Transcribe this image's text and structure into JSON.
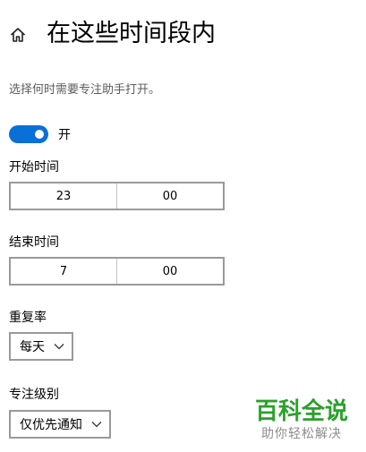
{
  "header": {
    "title": "在这些时间段内",
    "home_icon": "home-icon"
  },
  "description": "选择何时需要专注助手打开。",
  "toggle": {
    "state_label": "开",
    "on": true,
    "color": "#0a6fd6"
  },
  "start_time": {
    "label": "开始时间",
    "hour": "23",
    "minute": "00"
  },
  "end_time": {
    "label": "结束时间",
    "hour": "7",
    "minute": "00"
  },
  "repeat": {
    "label": "重复率",
    "value": "每天"
  },
  "focus_level": {
    "label": "专注级别",
    "value": "仅优先通知"
  },
  "watermark": {
    "title": "百科全说",
    "subtitle": "助你轻松解决",
    "color": "#2aa12a"
  }
}
